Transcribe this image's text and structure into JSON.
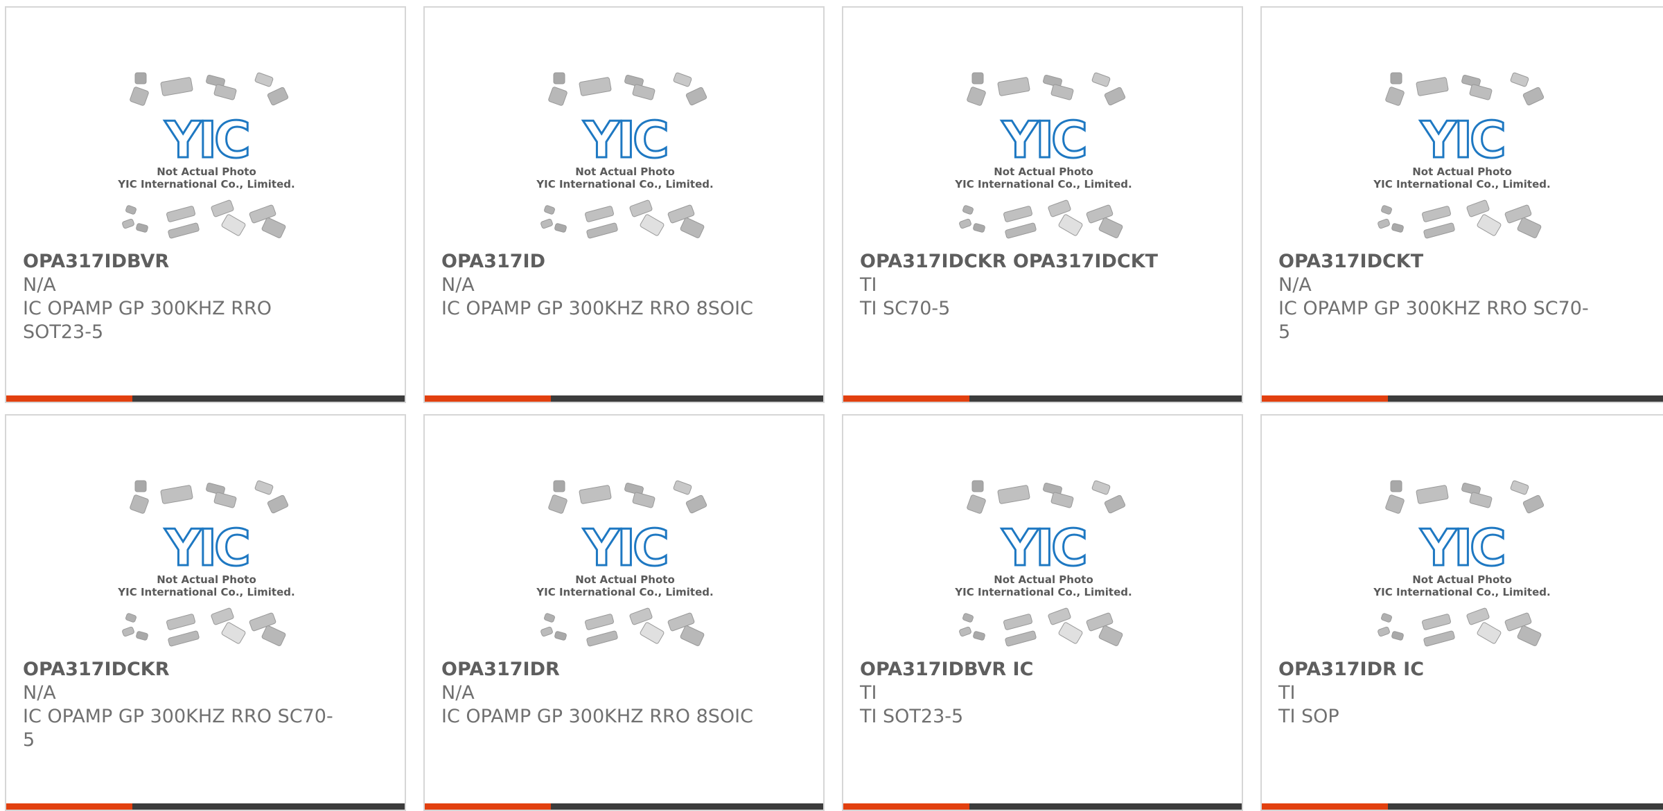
{
  "photo": {
    "caption_line1": "Not Actual Photo",
    "caption_line2": "YIC International Co., Limited.",
    "logo_text": "YIC",
    "icon": "chip-packages-placeholder"
  },
  "colors": {
    "accent": "#e2400f",
    "bar": "#3c3c3c",
    "logo_blue": "#1e78c2",
    "border": "#d6d6d6"
  },
  "products": [
    {
      "part_number": "OPA317IDBVR",
      "manufacturer": "N/A",
      "description": "IC OPAMP GP 300KHZ RRO SOT23-5"
    },
    {
      "part_number": "OPA317ID",
      "manufacturer": "N/A",
      "description": "IC OPAMP GP 300KHZ RRO 8SOIC"
    },
    {
      "part_number": "OPA317IDCKR OPA317IDCKT",
      "manufacturer": "TI",
      "description": "TI SC70-5"
    },
    {
      "part_number": "OPA317IDCKT",
      "manufacturer": "N/A",
      "description": "IC OPAMP GP 300KHZ RRO SC70-5"
    },
    {
      "part_number": "OPA317IDCKR",
      "manufacturer": "N/A",
      "description": "IC OPAMP GP 300KHZ RRO SC70-5"
    },
    {
      "part_number": "OPA317IDR",
      "manufacturer": "N/A",
      "description": "IC OPAMP GP 300KHZ RRO 8SOIC"
    },
    {
      "part_number": "OPA317IDBVR IC",
      "manufacturer": "TI",
      "description": "TI SOT23-5"
    },
    {
      "part_number": "OPA317IDR IC",
      "manufacturer": "TI",
      "description": "TI SOP"
    }
  ]
}
